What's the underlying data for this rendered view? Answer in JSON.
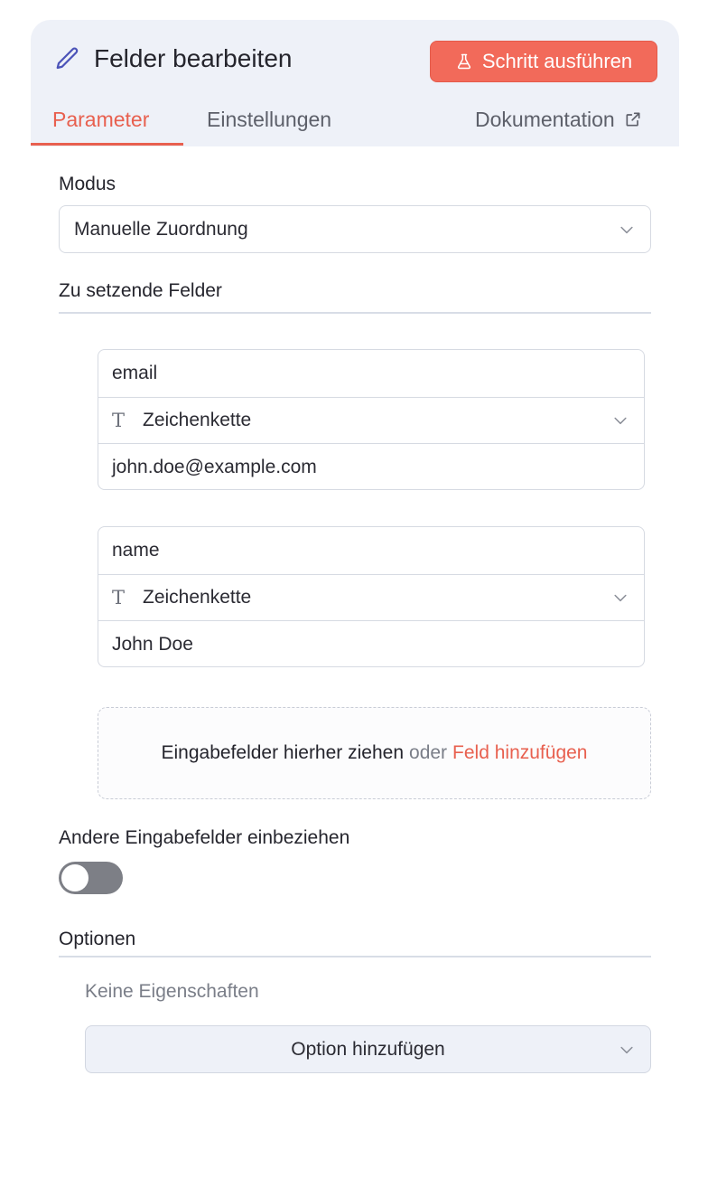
{
  "header": {
    "title": "Felder bearbeiten",
    "icon": "pencil-icon",
    "run_button": {
      "label": "Schritt ausführen",
      "icon": "flask-icon",
      "color": "#f26a5a"
    }
  },
  "tabs": [
    {
      "label": "Parameter",
      "active": true
    },
    {
      "label": "Einstellungen",
      "active": false
    },
    {
      "label": "Dokumentation",
      "active": false,
      "icon": "external-link-icon"
    }
  ],
  "mode": {
    "label": "Modus",
    "value": "Manuelle Zuordnung"
  },
  "fields_section": {
    "label": "Zu setzende Felder",
    "fields": [
      {
        "name": "email",
        "type": "Zeichenkette",
        "value": "john.doe@example.com"
      },
      {
        "name": "name",
        "type": "Zeichenkette",
        "value": "John Doe"
      }
    ],
    "dropzone": {
      "text": "Eingabefelder hierher ziehen",
      "or": "oder",
      "link": "Feld hinzufügen"
    }
  },
  "include_other": {
    "label": "Andere Eingabefelder einbeziehen",
    "enabled": false
  },
  "options": {
    "label": "Optionen",
    "empty_text": "Keine Eigenschaften",
    "add_button": "Option hinzufügen"
  },
  "colors": {
    "accent": "#e8604f",
    "header_bg": "#eef1f8"
  }
}
